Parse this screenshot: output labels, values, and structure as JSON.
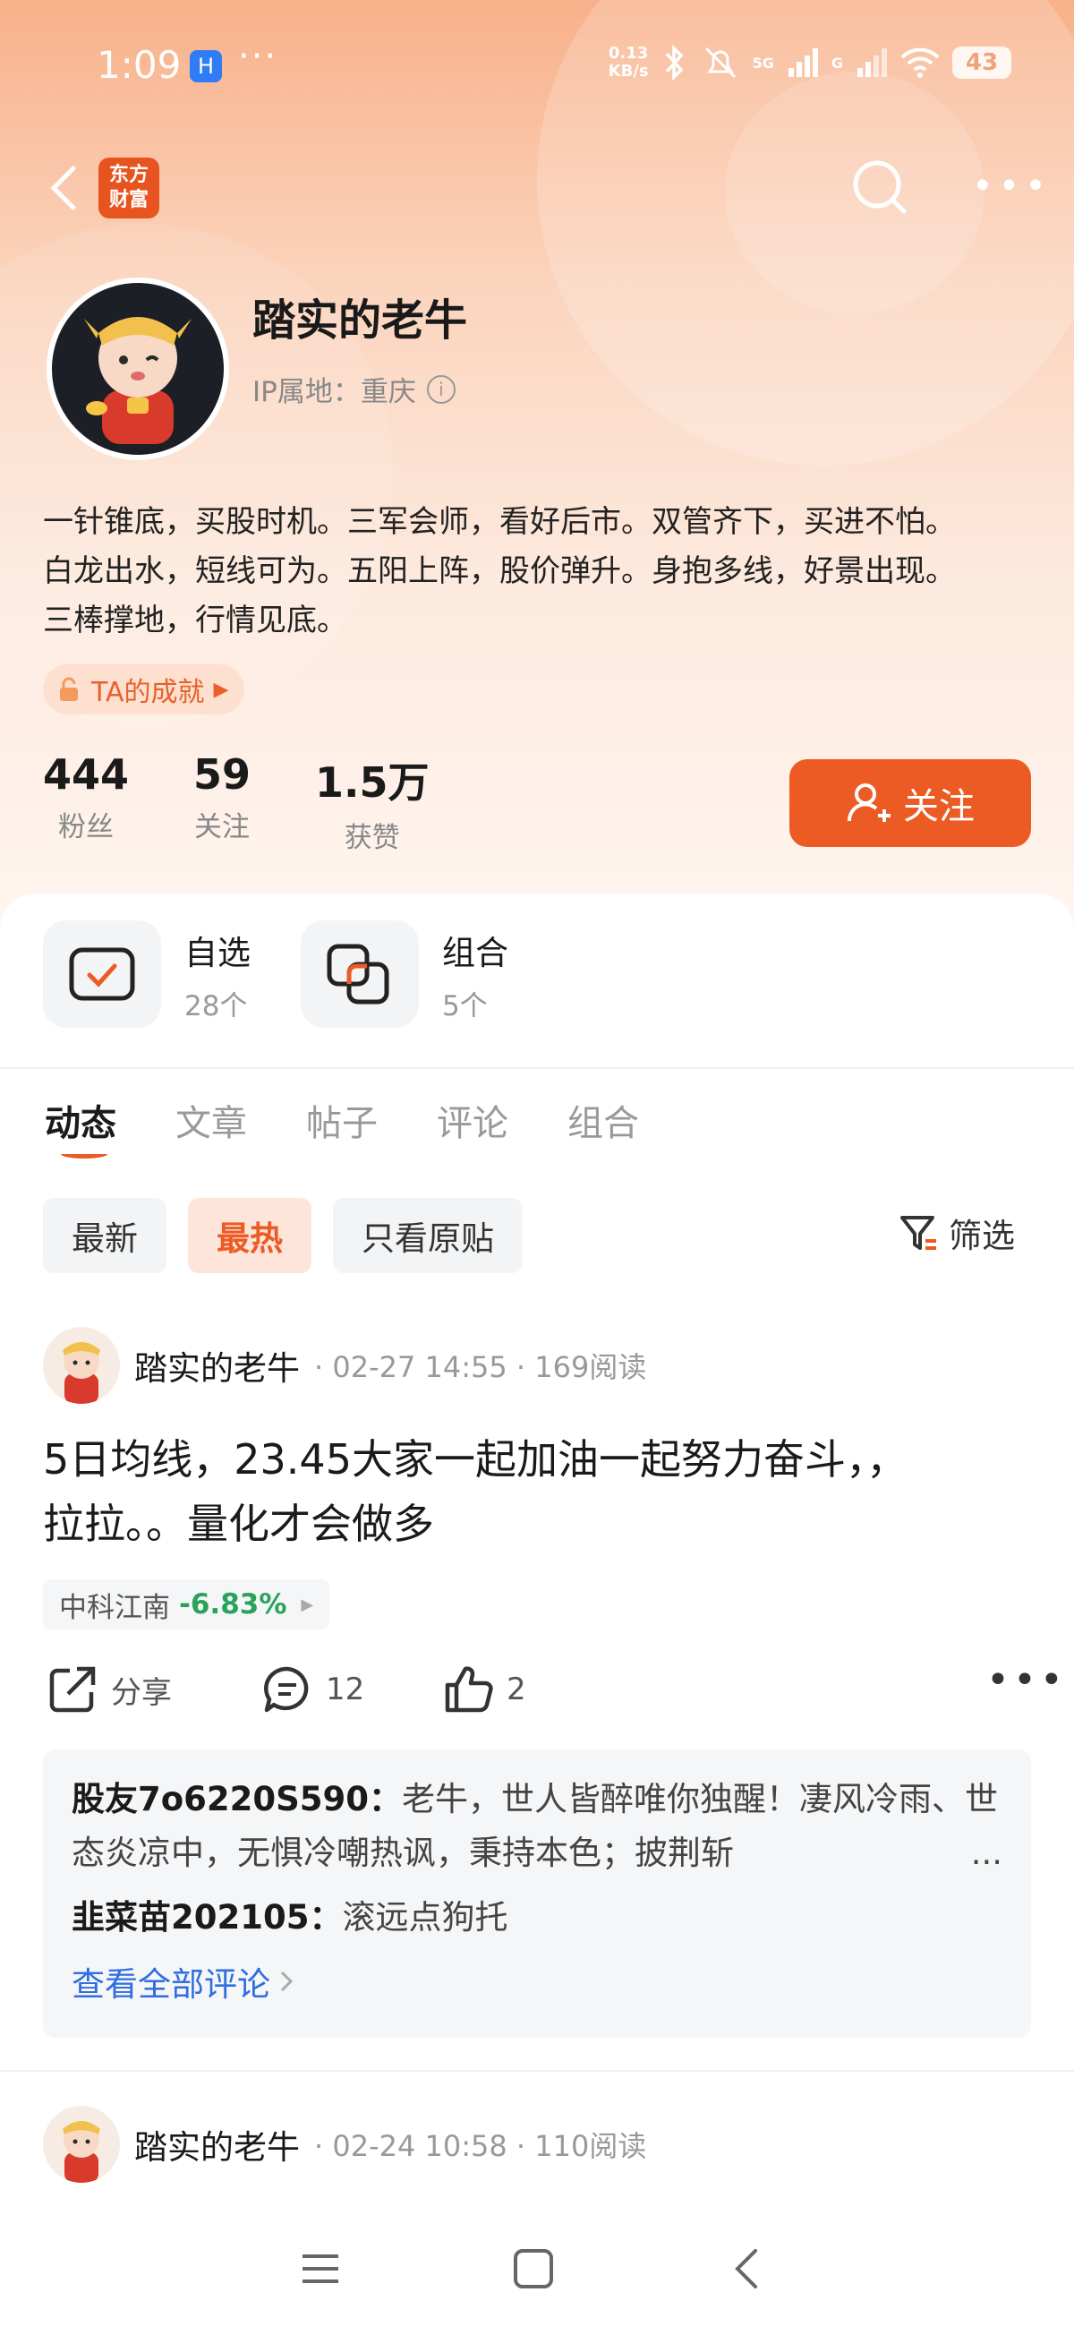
{
  "status_bar": {
    "time": "1:09",
    "app_badge": "H",
    "dots": "···",
    "net_speed_value": "0.13",
    "net_speed_unit": "KB/s",
    "signal_label_1": "5G",
    "signal_label_2": "G",
    "battery": "43"
  },
  "nav": {
    "brand_line1": "东方",
    "brand_line2": "财富"
  },
  "profile": {
    "name": "踏实的老牛",
    "ip_label": "IP属地：",
    "ip_value": "重庆",
    "bio_line1": "一针锥底，买股时机。三军会师，看好后市。双管齐下，买进不怕。",
    "bio_line2": "白龙出水，短线可为。五阳上阵，股价弹升。身抱多线，好景出现。",
    "bio_line3": "三棒撑地，行情见底。",
    "achievement": "TA的成就",
    "stats": [
      {
        "value": "444",
        "label": "粉丝"
      },
      {
        "value": "59",
        "label": "关注"
      },
      {
        "value": "1.5万",
        "label": "获赞"
      }
    ],
    "follow_label": "关注"
  },
  "quick": {
    "watchlist_title": "自选",
    "watchlist_count": "28个",
    "portfolio_title": "组合",
    "portfolio_count": "5个"
  },
  "tabs": [
    "动态",
    "文章",
    "帖子",
    "评论",
    "组合"
  ],
  "filters": {
    "chips": [
      "最新",
      "最热",
      "只看原贴"
    ],
    "filter_label": "筛选"
  },
  "posts": [
    {
      "author": "踏实的老牛",
      "meta": "· 02-27 14:55 · 169阅读",
      "text_line1": "5日均线，23.45大家一起加油一起努力奋斗，，",
      "text_line2": "拉拉。。量化才会做多",
      "stock_name": "中科江南",
      "stock_change": "-6.83%",
      "share_label": "分享",
      "comment_count": "12",
      "like_count": "2",
      "comments": [
        {
          "user": "股友7o6220S590：",
          "text": "老牛，世人皆醉唯你独醒！凄风冷雨、世态炎凉中，无惧冷嘲热讽，秉持本色；披荆斩",
          "ellipsis": "..."
        },
        {
          "user": "韭菜苗202105：",
          "text": "滚远点狗托"
        }
      ],
      "see_all": "查看全部评论"
    },
    {
      "author": "踏实的老牛",
      "meta": "· 02-24 10:58 · 110阅读"
    }
  ],
  "colors": {
    "accent": "#ec5b23",
    "link": "#2f6de0",
    "down_green": "#2aa35a"
  }
}
